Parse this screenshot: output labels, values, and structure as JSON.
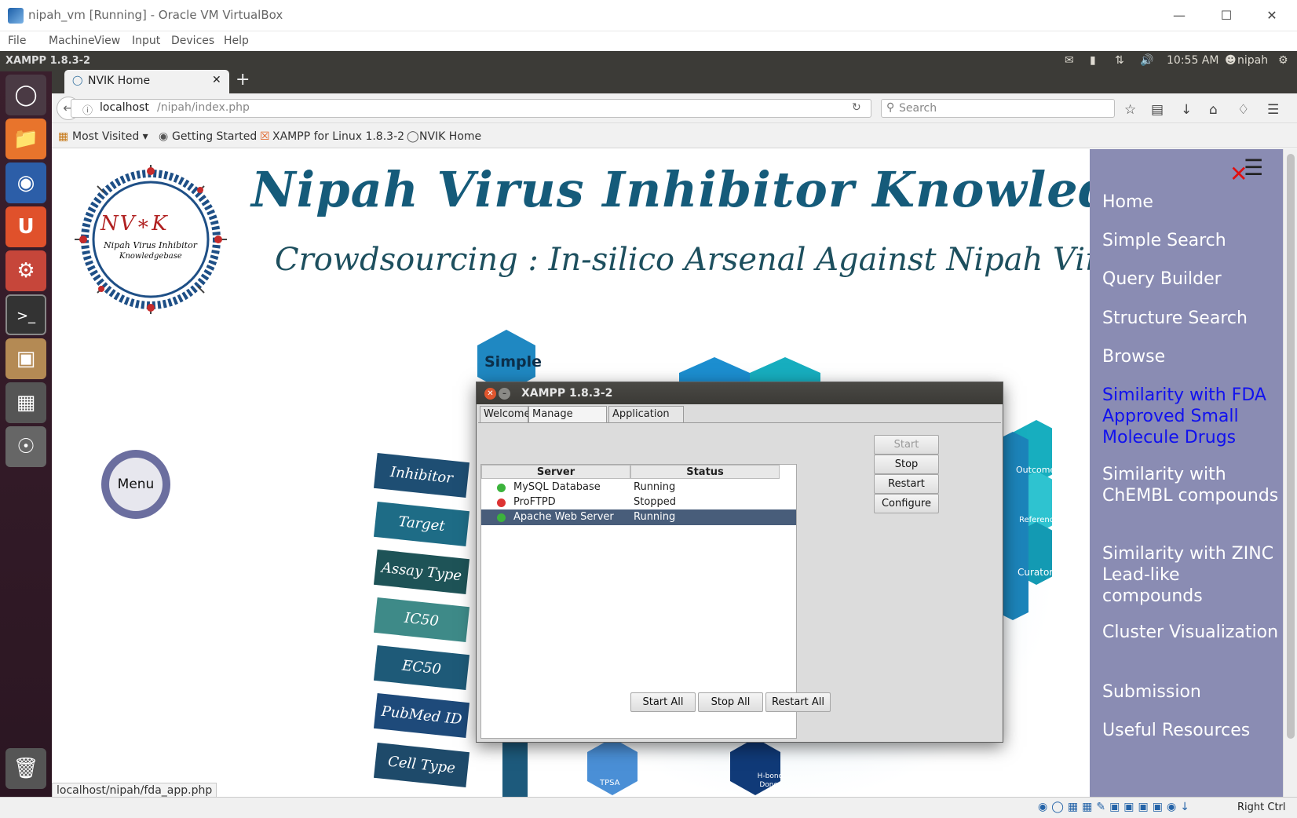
{
  "window": {
    "title": "nipah_vm [Running] - Oracle VM VirtualBox"
  },
  "vbox_menu": [
    "File",
    "Machine",
    "View",
    "Input",
    "Devices",
    "Help"
  ],
  "ubuntu_panel": {
    "app_title": "XAMPP 1.8.3-2",
    "time": "10:55 AM",
    "user": "nipah"
  },
  "firefox": {
    "tab_title": "NVIK Home",
    "url_host": "localhost",
    "url_path": "/nipah/index.php",
    "search_placeholder": "Search",
    "bookmarks": [
      "Most Visited ▾",
      "Getting Started",
      "XAMPP for Linux 1.8.3-2",
      "NVIK Home"
    ],
    "status_url": "localhost/nipah/fda_app.php"
  },
  "site": {
    "title": "Nipah Virus Inhibitor Knowledgebase",
    "subtitle": "Crowdsourcing : In-silico Arsenal Against Nipah Virus",
    "logo_text": "NV∗K",
    "logo_sub1": "Nipah Virus Inhibitor",
    "logo_sub2": "Knowledgebase",
    "menu_button": "Menu",
    "tags": [
      "Inhibitor Name",
      "Target",
      "Assay Type",
      "IC50",
      "EC50",
      "PubMed ID",
      "Cell Type"
    ],
    "hex_labels": [
      "Simple",
      "Outcome",
      "Reference",
      "Curator",
      "TPSA",
      "H-bond Donor"
    ],
    "sidebar": [
      {
        "label": "Home"
      },
      {
        "label": "Simple Search"
      },
      {
        "label": "Query Builder"
      },
      {
        "label": "Structure Search"
      },
      {
        "label": "Browse"
      },
      {
        "label": "Similarity with FDA Approved Small Molecule Drugs"
      },
      {
        "label": "Similarity with ChEMBL compounds"
      },
      {
        "label": "Similarity with ZINC Lead-like compounds"
      },
      {
        "label": "Cluster Visualization"
      },
      {
        "label": "Submission"
      },
      {
        "label": "Useful Resources"
      }
    ]
  },
  "xampp": {
    "title": "XAMPP 1.8.3-2",
    "tabs": [
      "Welcome",
      "Manage Servers",
      "Application log"
    ],
    "columns": [
      "Server",
      "Status"
    ],
    "servers": [
      {
        "name": "MySQL Database",
        "status": "Running"
      },
      {
        "name": "ProFTPD",
        "status": "Stopped"
      },
      {
        "name": "Apache Web Server",
        "status": "Running"
      }
    ],
    "side_buttons": [
      "Start",
      "Stop",
      "Restart",
      "Configure"
    ],
    "bottom_buttons": [
      "Start All",
      "Stop All",
      "Restart All"
    ]
  },
  "vbox_status": {
    "host_key": "Right Ctrl"
  },
  "colors": {
    "sidebar_bg": "#8a8cb3",
    "active_link": "#1111ee",
    "title_blue": "#155b7a",
    "running": "#3cb33c",
    "stopped": "#d33"
  }
}
